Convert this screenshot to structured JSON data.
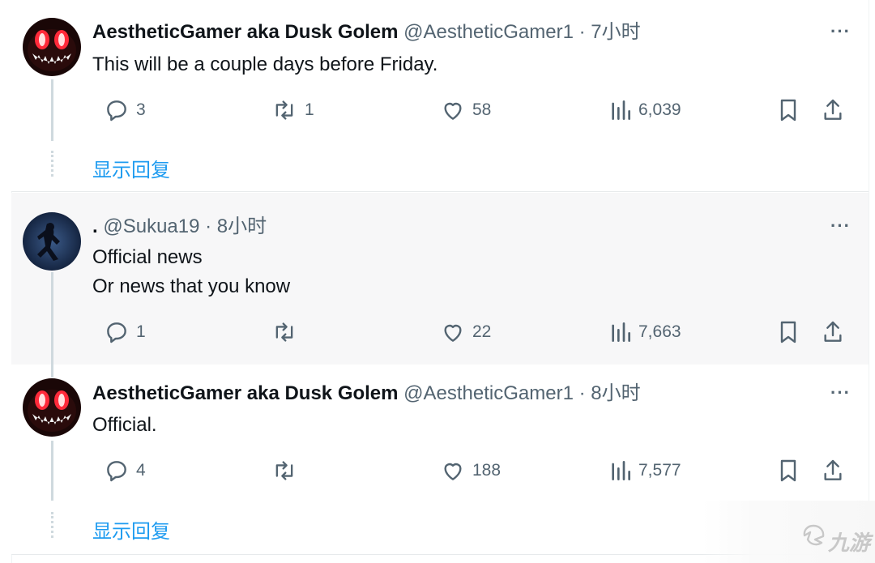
{
  "tweets": [
    {
      "name": "AestheticGamer aka Dusk Golem",
      "handle": "@AestheticGamer1 · 7小时",
      "lines": [
        "This will be a couple days before Friday."
      ],
      "replies": "3",
      "retweets": "1",
      "likes": "58",
      "views": "6,039",
      "more": "···",
      "show_replies": "显示回复"
    },
    {
      "name": ".",
      "handle": "@Sukua19 · 8小时",
      "lines": [
        "Official news",
        "Or news that you know"
      ],
      "replies": "1",
      "retweets": "",
      "likes": "22",
      "views": "7,663",
      "more": "···"
    },
    {
      "name": "AestheticGamer aka Dusk Golem",
      "handle": "@AestheticGamer1 · 8小时",
      "lines": [
        "Official."
      ],
      "replies": "4",
      "retweets": "",
      "likes": "188",
      "views": "7,577",
      "more": "···",
      "show_replies": "显示回复"
    }
  ],
  "watermark": {
    "text": "九游"
  },
  "colors": {
    "link": "#1d9bf0",
    "muted": "#536471",
    "text": "#0f1419",
    "highlight_bg": "#f7f7f8"
  }
}
